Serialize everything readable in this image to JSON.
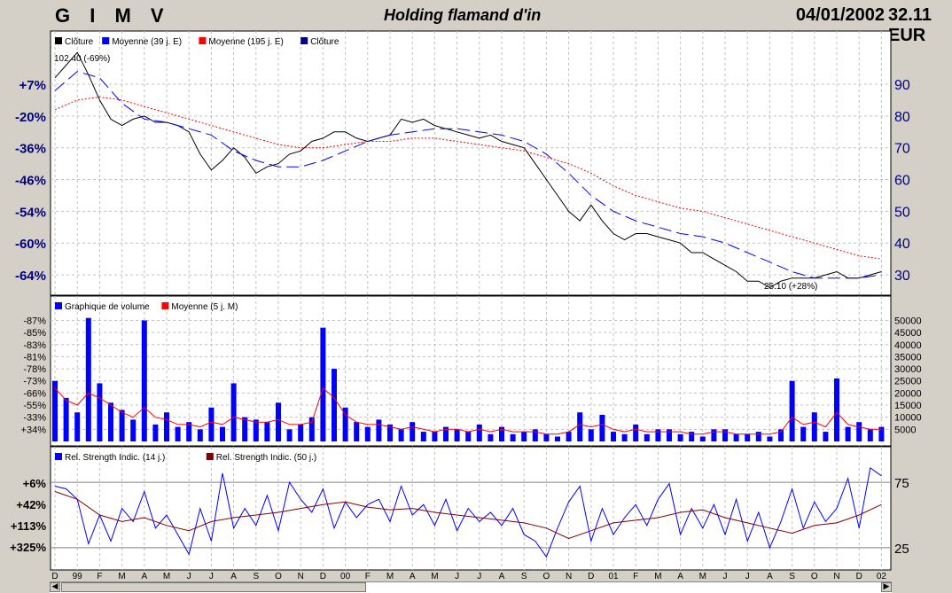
{
  "header": {
    "ticker": "G I M V",
    "name": "Holding flamand d'in",
    "date": "04/01/2002",
    "price": "32.11 EUR"
  },
  "chart_data": [
    {
      "type": "line",
      "legend": [
        "Clôture",
        "Moyenne (39 j. E)",
        "Moyenne (195 j. E)",
        "Clôture"
      ],
      "legend_colors": [
        "#000000",
        "#0000ff",
        "#ff0000",
        "#000080"
      ],
      "annotations": {
        "high": "102.40 (-69%)",
        "low": "25.10 (+28%)"
      },
      "y_right_ticks": [
        30,
        40,
        50,
        60,
        70,
        80,
        90
      ],
      "y_left_ticks": [
        "-64%",
        "-60%",
        "-54%",
        "-46%",
        "-36%",
        "-20%",
        "+7%"
      ],
      "ylim": [
        25,
        102
      ],
      "x_ticks": [
        "D",
        "99",
        "F",
        "M",
        "A",
        "M",
        "J",
        "J",
        "A",
        "S",
        "O",
        "N",
        "D",
        "00",
        "F",
        "M",
        "A",
        "M",
        "J",
        "J",
        "A",
        "S",
        "O",
        "N",
        "D",
        "01",
        "F",
        "M",
        "A",
        "M",
        "J",
        "J",
        "A",
        "S",
        "O",
        "N",
        "D",
        "02"
      ],
      "series": [
        {
          "name": "Clôture",
          "color": "#000000",
          "x": [
            0,
            0.5,
            1,
            1.5,
            2,
            2.5,
            3,
            3.5,
            4,
            4.5,
            5,
            5.5,
            6,
            6.5,
            7,
            7.5,
            8,
            8.5,
            9,
            9.5,
            10,
            10.5,
            11,
            11.5,
            12,
            12.5,
            13,
            13.5,
            14,
            14.5,
            15,
            15.5,
            16,
            16.5,
            17,
            17.5,
            18,
            18.5,
            19,
            19.5,
            20,
            20.5,
            21,
            21.5,
            22,
            22.5,
            23,
            23.5,
            24,
            24.5,
            25,
            25.5,
            26,
            26.5,
            27,
            27.5,
            28,
            28.5,
            29,
            29.5,
            30,
            30.5,
            31,
            31.5,
            32,
            32.5,
            33,
            33.5,
            34,
            34.5,
            35,
            35.5,
            36,
            36.5,
            37
          ],
          "values": [
            92,
            96,
            100,
            93,
            85,
            79,
            77,
            79,
            80,
            78,
            78,
            77,
            75,
            68,
            63,
            66,
            70,
            67,
            62,
            64,
            65,
            68,
            69,
            72,
            73,
            75,
            75,
            73,
            72,
            73,
            74,
            79,
            78,
            79,
            77,
            76,
            75,
            74,
            73,
            74,
            72,
            71,
            70,
            65,
            60,
            55,
            50,
            47,
            52,
            47,
            43,
            41,
            43,
            43,
            42,
            41,
            40,
            37,
            37,
            35,
            33,
            31,
            28,
            28,
            26,
            28,
            29,
            29,
            29,
            30,
            31,
            29,
            29,
            30,
            31
          ]
        },
        {
          "name": "Moyenne (39 j. E)",
          "color": "#0000ff",
          "x": [
            0,
            1,
            2,
            3,
            4,
            5,
            6,
            7,
            8,
            9,
            10,
            11,
            12,
            13,
            14,
            15,
            16,
            17,
            18,
            19,
            20,
            21,
            22,
            23,
            24,
            25,
            26,
            27,
            28,
            29,
            30,
            31,
            32,
            33,
            34,
            35,
            36,
            37
          ],
          "values": [
            88,
            94,
            92,
            84,
            79,
            78,
            76,
            74,
            69,
            66,
            64,
            64,
            66,
            69,
            72,
            74,
            75,
            76,
            76,
            75,
            74,
            72,
            68,
            62,
            55,
            50,
            47,
            45,
            43,
            42,
            40,
            37,
            34,
            31,
            29,
            29,
            29,
            30
          ]
        },
        {
          "name": "Moyenne (195 j. E)",
          "color": "#ff0000",
          "x": [
            0,
            1,
            2,
            3,
            4,
            5,
            6,
            7,
            8,
            9,
            10,
            11,
            12,
            13,
            14,
            15,
            16,
            17,
            18,
            19,
            20,
            21,
            22,
            23,
            24,
            25,
            26,
            27,
            28,
            29,
            30,
            31,
            32,
            33,
            34,
            35,
            36,
            37
          ],
          "values": [
            82,
            85,
            86,
            85,
            83,
            81,
            79,
            77,
            75,
            73,
            71,
            70,
            70,
            71,
            72,
            72,
            73,
            73,
            72,
            71,
            70,
            69,
            67,
            65,
            62,
            58,
            55,
            53,
            51,
            50,
            48,
            46,
            44,
            42,
            40,
            38,
            36,
            35
          ]
        }
      ]
    },
    {
      "type": "bar",
      "legend": [
        "Graphique de volume",
        "Moyenne (5 j. M)"
      ],
      "legend_colors": [
        "#0000ff",
        "#ff0000"
      ],
      "y_right_ticks": [
        "5000",
        "10000",
        "15000",
        "20000",
        "25000",
        "30000",
        "35000",
        "40000",
        "45000",
        "50000"
      ],
      "y_left_ticks": [
        "+34%",
        "-33%",
        "-55%",
        "-66%",
        "-73%",
        "-78%",
        "-81%",
        "-83%",
        "-85%",
        "-87%"
      ],
      "ylim": [
        0,
        52000
      ],
      "x": [
        0,
        0.5,
        1,
        1.5,
        2,
        2.5,
        3,
        3.5,
        4,
        4.5,
        5,
        5.5,
        6,
        6.5,
        7,
        7.5,
        8,
        8.5,
        9,
        9.5,
        10,
        10.5,
        11,
        11.5,
        12,
        12.5,
        13,
        13.5,
        14,
        14.5,
        15,
        15.5,
        16,
        16.5,
        17,
        17.5,
        18,
        18.5,
        19,
        19.5,
        20,
        20.5,
        21,
        21.5,
        22,
        22.5,
        23,
        23.5,
        24,
        24.5,
        25,
        25.5,
        26,
        26.5,
        27,
        27.5,
        28,
        28.5,
        29,
        29.5,
        30,
        30.5,
        31,
        31.5,
        32,
        32.5,
        33,
        33.5,
        34,
        34.5,
        35,
        35.5,
        36,
        36.5,
        37
      ],
      "values": [
        25000,
        18000,
        12000,
        51000,
        24000,
        16000,
        13000,
        9000,
        50000,
        7000,
        12000,
        6000,
        8000,
        5000,
        14000,
        6000,
        24000,
        10000,
        9000,
        8000,
        16000,
        5000,
        7000,
        10000,
        47000,
        30000,
        14000,
        8000,
        6000,
        9000,
        7000,
        5000,
        8000,
        4000,
        4000,
        6000,
        5000,
        4000,
        7000,
        3000,
        6000,
        3000,
        4000,
        5000,
        3000,
        2000,
        4000,
        12000,
        5000,
        11000,
        4000,
        3000,
        7000,
        3000,
        5000,
        5000,
        3000,
        4000,
        2000,
        5000,
        5000,
        3000,
        3000,
        4000,
        2000,
        5000,
        25000,
        6000,
        12000,
        4000,
        26000,
        6000,
        8000,
        5000,
        6000
      ],
      "series": [
        {
          "name": "Moyenne (5 j. M)",
          "color": "#ff0000",
          "values": [
            22000,
            17000,
            15000,
            20000,
            18000,
            15000,
            12000,
            10000,
            14000,
            10000,
            9000,
            7000,
            7000,
            6000,
            8000,
            7000,
            10000,
            9000,
            8000,
            8000,
            9000,
            7000,
            7000,
            8000,
            22000,
            18000,
            11000,
            8000,
            7000,
            7000,
            6000,
            5000,
            6000,
            5000,
            4000,
            5000,
            5000,
            4000,
            5000,
            4000,
            5000,
            4000,
            4000,
            4000,
            3000,
            3000,
            4000,
            7000,
            6000,
            7000,
            5000,
            4000,
            5000,
            4000,
            4000,
            4000,
            4000,
            3000,
            3000,
            4000,
            4000,
            3000,
            3000,
            3000,
            3000,
            4000,
            10000,
            7000,
            8000,
            6000,
            12000,
            7000,
            6000,
            5000,
            5000
          ]
        }
      ]
    },
    {
      "type": "line",
      "legend": [
        "Rel. Strength Indic. (14 j.)",
        "Rel. Strength Indic. (50 j.)"
      ],
      "legend_colors": [
        "#0000ff",
        "#800000"
      ],
      "y_right_ticks": [
        25,
        75
      ],
      "y_left_ticks": [
        "+6%",
        "+42%",
        "+113%",
        "+325%"
      ],
      "ylim": [
        10,
        90
      ],
      "series": [
        {
          "name": "Rel. Strength Indic. (14 j.)",
          "color": "#0000ff",
          "x": [
            0,
            0.5,
            1,
            1.5,
            2,
            2.5,
            3,
            3.5,
            4,
            4.5,
            5,
            5.5,
            6,
            6.5,
            7,
            7.5,
            8,
            8.5,
            9,
            9.5,
            10,
            10.5,
            11,
            11.5,
            12,
            12.5,
            13,
            13.5,
            14,
            14.5,
            15,
            15.5,
            16,
            16.5,
            17,
            17.5,
            18,
            18.5,
            19,
            19.5,
            20,
            20.5,
            21,
            21.5,
            22,
            22.5,
            23,
            23.5,
            24,
            24.5,
            25,
            25.5,
            26,
            26.5,
            27,
            27.5,
            28,
            28.5,
            29,
            29.5,
            30,
            30.5,
            31,
            31.5,
            32,
            32.5,
            33,
            33.5,
            34,
            34.5,
            35,
            35.5,
            36,
            36.5,
            37
          ],
          "values": [
            72,
            70,
            62,
            28,
            50,
            30,
            55,
            45,
            68,
            40,
            50,
            35,
            20,
            55,
            30,
            82,
            40,
            55,
            42,
            65,
            38,
            75,
            62,
            52,
            70,
            40,
            60,
            48,
            58,
            62,
            45,
            72,
            50,
            58,
            42,
            62,
            38,
            55,
            45,
            52,
            42,
            55,
            35,
            30,
            18,
            40,
            60,
            72,
            30,
            55,
            35,
            48,
            58,
            42,
            62,
            74,
            35,
            55,
            40,
            58,
            35,
            62,
            30,
            52,
            25,
            45,
            70,
            40,
            60,
            45,
            55,
            78,
            40,
            86,
            80
          ]
        },
        {
          "name": "Rel. Strength Indic. (50 j.)",
          "color": "#800000",
          "x": [
            0,
            1,
            2,
            3,
            4,
            5,
            6,
            7,
            8,
            9,
            10,
            11,
            12,
            13,
            14,
            15,
            16,
            17,
            18,
            19,
            20,
            21,
            22,
            23,
            24,
            25,
            26,
            27,
            28,
            29,
            30,
            31,
            32,
            33,
            34,
            35,
            36,
            37
          ],
          "values": [
            68,
            62,
            50,
            45,
            48,
            42,
            38,
            45,
            48,
            50,
            52,
            55,
            58,
            60,
            56,
            54,
            55,
            52,
            50,
            48,
            46,
            44,
            40,
            32,
            38,
            44,
            46,
            48,
            52,
            54,
            48,
            44,
            40,
            36,
            42,
            44,
            50,
            58
          ]
        }
      ]
    }
  ]
}
